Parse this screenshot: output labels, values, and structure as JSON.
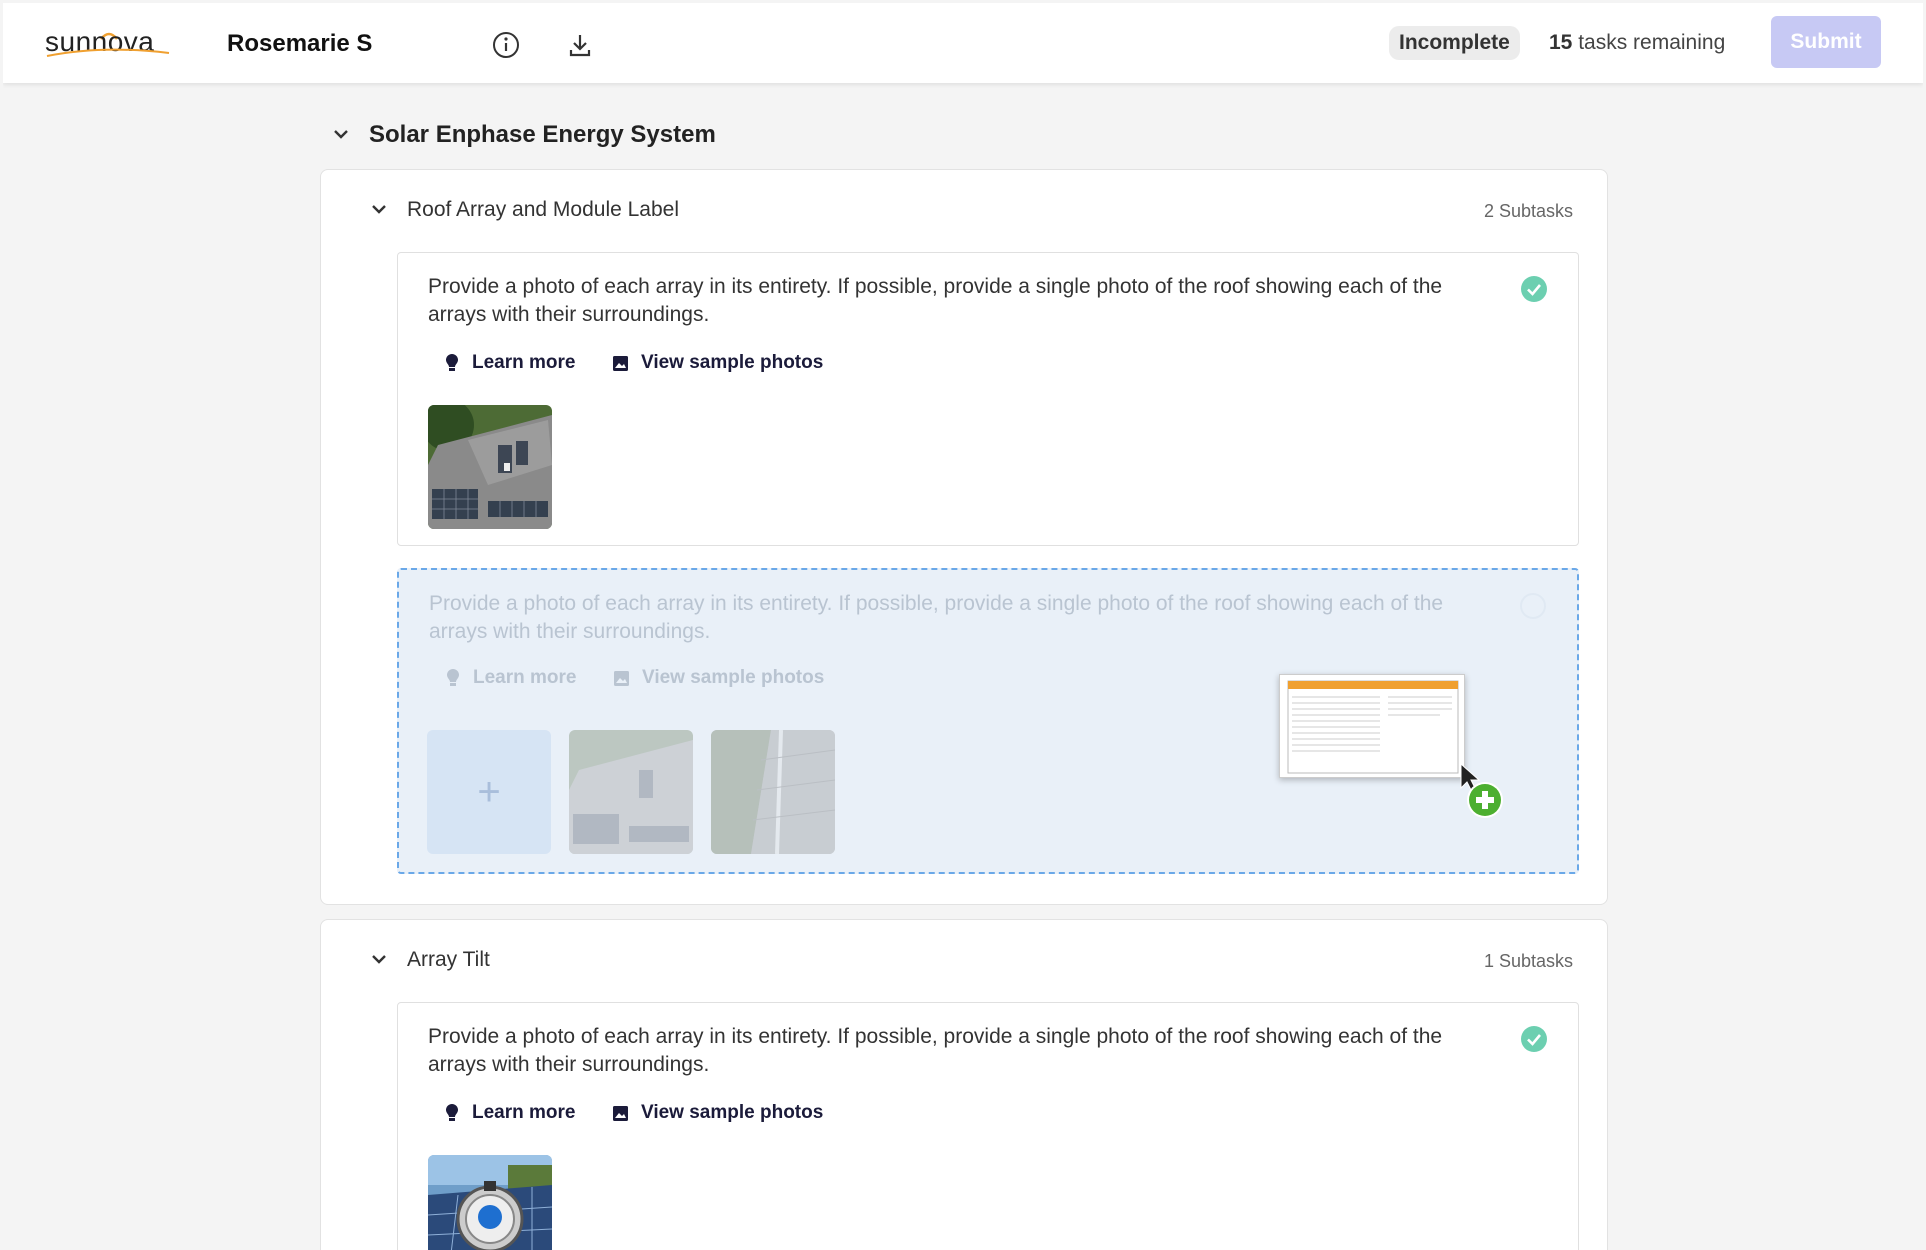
{
  "header": {
    "logo_text": "sunnova",
    "customer_name": "Rosemarie S.",
    "status": "Incomplete",
    "tasks_count": "15",
    "tasks_label": "tasks remaining",
    "submit_label": "Submit"
  },
  "section": {
    "title": "Solar Enphase Energy System",
    "groups": [
      {
        "title": "Roof Array and Module Label",
        "subtasks": "2 Subtasks",
        "tasks": [
          {
            "description": "Provide a photo of each array in its entirety. If possible, provide a single photo of the roof showing each of the arrays with their surroundings.",
            "learn_more": "Learn more",
            "view_samples": "View sample photos",
            "status": "complete"
          },
          {
            "description": "Provide a photo of each array in its entirety. If possible, provide a single photo of the roof showing each of the arrays with their surroundings.",
            "learn_more": "Learn more",
            "view_samples": "View sample photos",
            "add_label": "+",
            "state": "drag-over"
          }
        ]
      },
      {
        "title": "Array Tilt",
        "subtasks": "1 Subtasks",
        "tasks": [
          {
            "description": "Provide a photo of each array in its entirety. If possible, provide a single photo of the roof showing each of the arrays with their surroundings.",
            "learn_more": "Learn more",
            "view_samples": "View sample photos",
            "status": "complete"
          }
        ]
      }
    ]
  },
  "colors": {
    "accent_check": "#6ccfb0",
    "submit_disabled": "#c7c9f4",
    "dropzone_border": "#6aa8e8",
    "dropzone_bg": "#e9f0f8",
    "logo_orange": "#f0a030"
  }
}
